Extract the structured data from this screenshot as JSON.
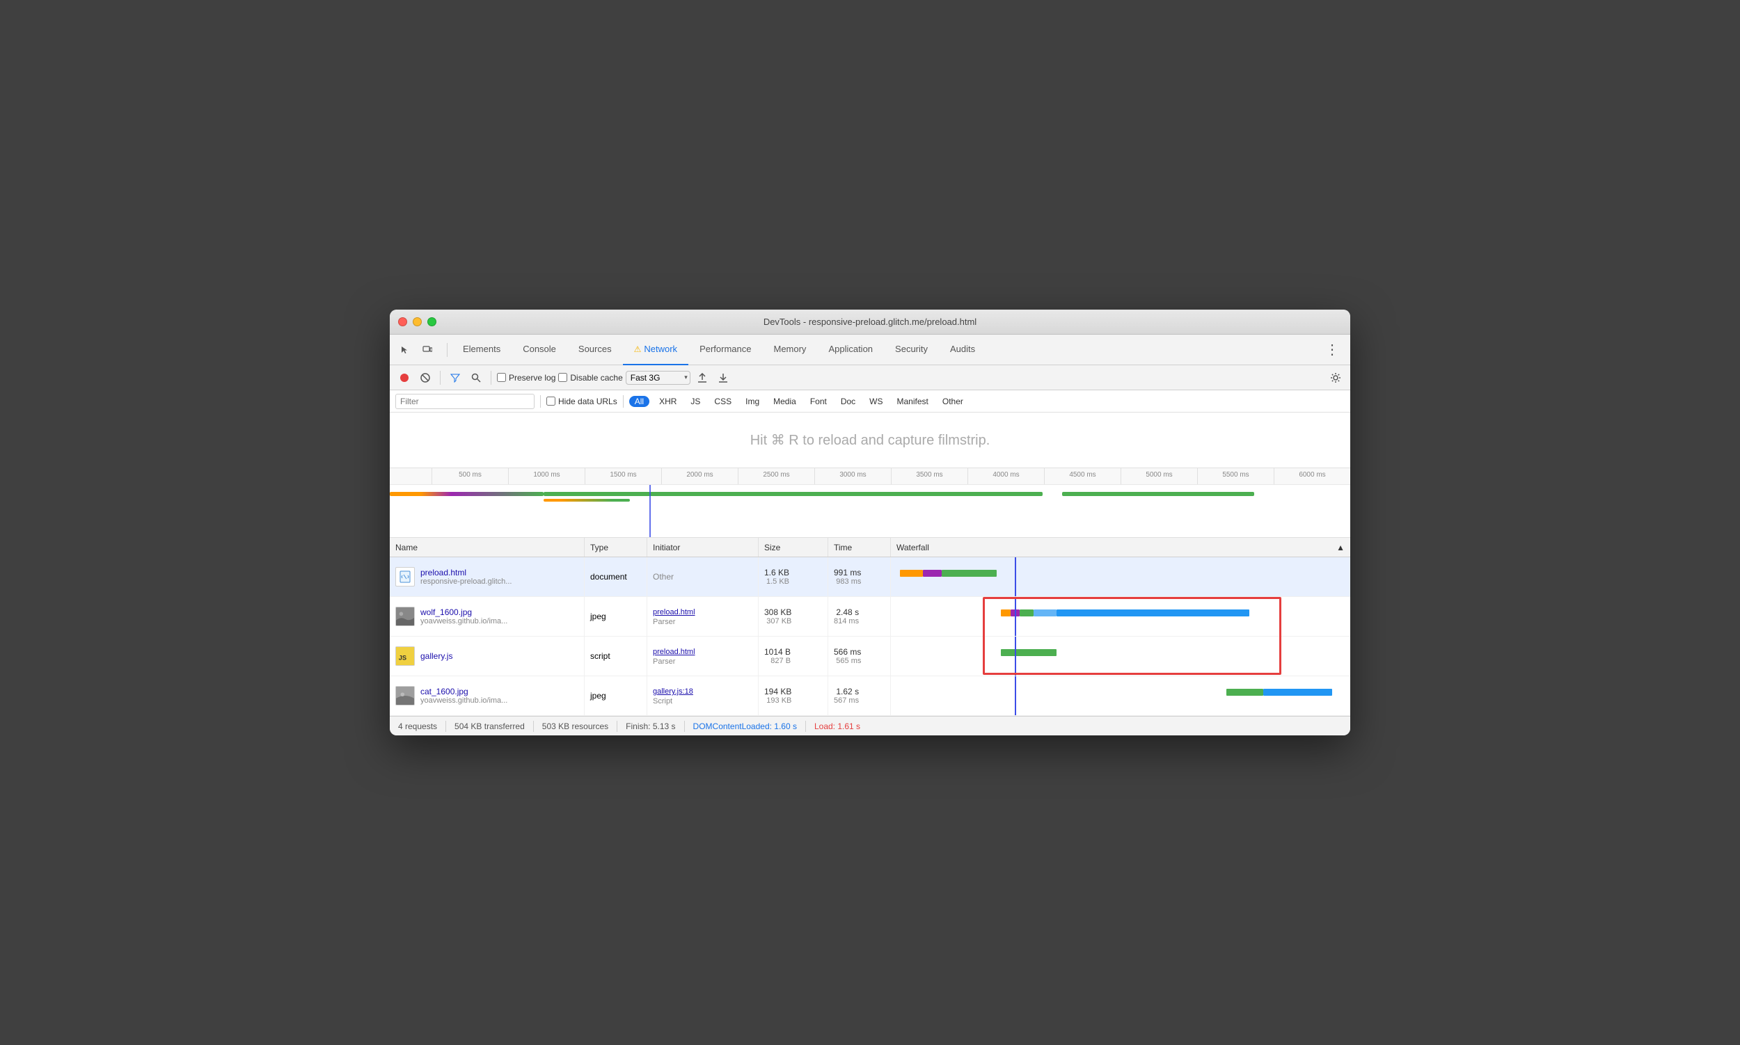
{
  "window": {
    "title": "DevTools - responsive-preload.glitch.me/preload.html"
  },
  "tabs": [
    {
      "label": "Elements",
      "active": false
    },
    {
      "label": "Console",
      "active": false
    },
    {
      "label": "Sources",
      "active": false
    },
    {
      "label": "Network",
      "active": true,
      "warning": true
    },
    {
      "label": "Performance",
      "active": false
    },
    {
      "label": "Memory",
      "active": false
    },
    {
      "label": "Application",
      "active": false
    },
    {
      "label": "Security",
      "active": false
    },
    {
      "label": "Audits",
      "active": false
    }
  ],
  "toolbar": {
    "preserve_log_label": "Preserve log",
    "disable_cache_label": "Disable cache",
    "throttle_option": "Fast 3G"
  },
  "filter": {
    "placeholder": "Filter",
    "hide_data_urls": "Hide data URLs",
    "types": [
      "All",
      "XHR",
      "JS",
      "CSS",
      "Img",
      "Media",
      "Font",
      "Doc",
      "WS",
      "Manifest",
      "Other"
    ]
  },
  "filmstrip": {
    "message": "Hit ⌘ R to reload and capture filmstrip."
  },
  "timeline": {
    "marks": [
      "500 ms",
      "1000 ms",
      "1500 ms",
      "2000 ms",
      "2500 ms",
      "3000 ms",
      "3500 ms",
      "4000 ms",
      "4500 ms",
      "5000 ms",
      "5500 ms",
      "6000 ms"
    ]
  },
  "table": {
    "headers": [
      "Name",
      "Type",
      "Initiator",
      "Size",
      "Time",
      "Waterfall"
    ],
    "sort_icon": "▲",
    "rows": [
      {
        "name": "preload.html",
        "url": "responsive-preload.glitch...",
        "type": "document",
        "initiator_text": "Other",
        "initiator_link": null,
        "initiator_sub": null,
        "size_main": "1.6 KB",
        "size_sub": "1.5 KB",
        "time_main": "991 ms",
        "time_sub": "983 ms",
        "file_type": "html",
        "selected": true
      },
      {
        "name": "wolf_1600.jpg",
        "url": "yoavweiss.github.io/ima...",
        "type": "jpeg",
        "initiator_text": null,
        "initiator_link": "preload.html",
        "initiator_sub": "Parser",
        "size_main": "308 KB",
        "size_sub": "307 KB",
        "time_main": "2.48 s",
        "time_sub": "814 ms",
        "file_type": "jpg",
        "selected": false
      },
      {
        "name": "gallery.js",
        "url": null,
        "type": "script",
        "initiator_text": null,
        "initiator_link": "preload.html",
        "initiator_sub": "Parser",
        "size_main": "1014 B",
        "size_sub": "827 B",
        "time_main": "566 ms",
        "time_sub": "565 ms",
        "file_type": "js",
        "selected": false
      },
      {
        "name": "cat_1600.jpg",
        "url": "yoavweiss.github.io/ima...",
        "type": "jpeg",
        "initiator_text": null,
        "initiator_link": "gallery.js:18",
        "initiator_sub": "Script",
        "size_main": "194 KB",
        "size_sub": "193 KB",
        "time_main": "1.62 s",
        "time_sub": "567 ms",
        "file_type": "jpg",
        "selected": false
      }
    ]
  },
  "status_bar": {
    "requests": "4 requests",
    "transferred": "504 KB transferred",
    "resources": "503 KB resources",
    "finish": "Finish: 5.13 s",
    "dom_loaded": "DOMContentLoaded: 1.60 s",
    "load": "Load: 1.61 s"
  }
}
